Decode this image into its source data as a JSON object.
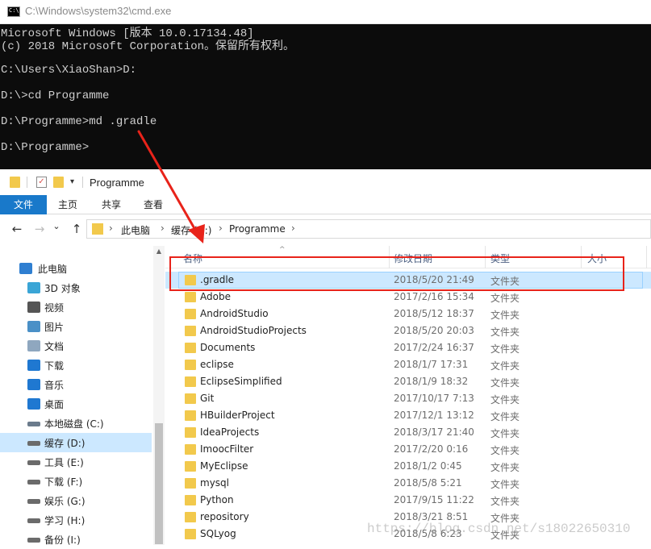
{
  "cmd": {
    "title": "C:\\Windows\\system32\\cmd.exe",
    "icon_text": "C:\\",
    "lines": [
      "Microsoft Windows [版本 10.0.17134.48]",
      "(c) 2018 Microsoft Corporation。保留所有权利。",
      "",
      "C:\\Users\\XiaoShan>D:",
      "",
      "D:\\>cd Programme",
      "",
      "D:\\Programme>md .gradle",
      "",
      "D:\\Programme>"
    ]
  },
  "explorer": {
    "title": "Programme",
    "ribbon_tabs": [
      "文件",
      "主页",
      "共享",
      "查看"
    ],
    "nav_buttons": {
      "back": "←",
      "forward": "→",
      "recent": "⌄",
      "up": "↑"
    },
    "breadcrumb": [
      "此电脑",
      "缓存 (D:)",
      "Programme"
    ],
    "breadcrumb_sep": "›",
    "nav_pane": [
      {
        "label": "此电脑",
        "icon": "computer-icon",
        "color": "#2f7fd1"
      },
      {
        "label": "3D 对象",
        "icon": "3d-objects-icon",
        "color": "#3aa5d6"
      },
      {
        "label": "视频",
        "icon": "video-icon",
        "color": "#555555"
      },
      {
        "label": "图片",
        "icon": "pictures-icon",
        "color": "#4a90c7"
      },
      {
        "label": "文档",
        "icon": "documents-icon",
        "color": "#8fa7bf"
      },
      {
        "label": "下载",
        "icon": "downloads-icon",
        "color": "#1f78d1"
      },
      {
        "label": "音乐",
        "icon": "music-icon",
        "color": "#1f78d1"
      },
      {
        "label": "桌面",
        "icon": "desktop-icon",
        "color": "#1f78d1"
      },
      {
        "label": "本地磁盘 (C:)",
        "icon": "drive-c-icon",
        "color": "#6b7b8c"
      },
      {
        "label": "缓存 (D:)",
        "icon": "drive-icon",
        "color": "#6b6b6b",
        "selected": true
      },
      {
        "label": "工具 (E:)",
        "icon": "drive-icon",
        "color": "#6b6b6b"
      },
      {
        "label": "下载 (F:)",
        "icon": "drive-icon",
        "color": "#6b6b6b"
      },
      {
        "label": "娱乐 (G:)",
        "icon": "drive-icon",
        "color": "#6b6b6b"
      },
      {
        "label": "学习 (H:)",
        "icon": "drive-icon",
        "color": "#6b6b6b"
      },
      {
        "label": "备份 (I:)",
        "icon": "drive-icon",
        "color": "#6b6b6b"
      }
    ],
    "columns": {
      "name": "名称",
      "date": "修改日期",
      "type": "类型",
      "size": "大小",
      "sort_indicator": "^"
    },
    "files": [
      {
        "name": ".gradle",
        "date": "2018/5/20 21:49",
        "type": "文件夹",
        "selected": true
      },
      {
        "name": "Adobe",
        "date": "2017/2/16 15:34",
        "type": "文件夹"
      },
      {
        "name": "AndroidStudio",
        "date": "2018/5/12 18:37",
        "type": "文件夹"
      },
      {
        "name": "AndroidStudioProjects",
        "date": "2018/5/20 20:03",
        "type": "文件夹"
      },
      {
        "name": "Documents",
        "date": "2017/2/24 16:37",
        "type": "文件夹"
      },
      {
        "name": "eclipse",
        "date": "2018/1/7 17:31",
        "type": "文件夹"
      },
      {
        "name": "EclipseSimplified",
        "date": "2018/1/9 18:32",
        "type": "文件夹"
      },
      {
        "name": "Git",
        "date": "2017/10/17 7:13",
        "type": "文件夹"
      },
      {
        "name": "HBuilderProject",
        "date": "2017/12/1 13:12",
        "type": "文件夹"
      },
      {
        "name": "IdeaProjects",
        "date": "2018/3/17 21:40",
        "type": "文件夹"
      },
      {
        "name": "ImoocFilter",
        "date": "2017/2/20 0:16",
        "type": "文件夹"
      },
      {
        "name": "MyEclipse",
        "date": "2018/1/2 0:45",
        "type": "文件夹"
      },
      {
        "name": "mysql",
        "date": "2018/5/8 5:21",
        "type": "文件夹"
      },
      {
        "name": "Python",
        "date": "2017/9/15 11:22",
        "type": "文件夹"
      },
      {
        "name": "repository",
        "date": "2018/3/21 8:51",
        "type": "文件夹"
      },
      {
        "name": "SQLyog",
        "date": "2018/5/8 6:23",
        "type": "文件夹"
      }
    ]
  },
  "annotation": {
    "highlight_color": "#e8231a"
  },
  "watermark": "https://blog.csdn.net/s18022650310"
}
